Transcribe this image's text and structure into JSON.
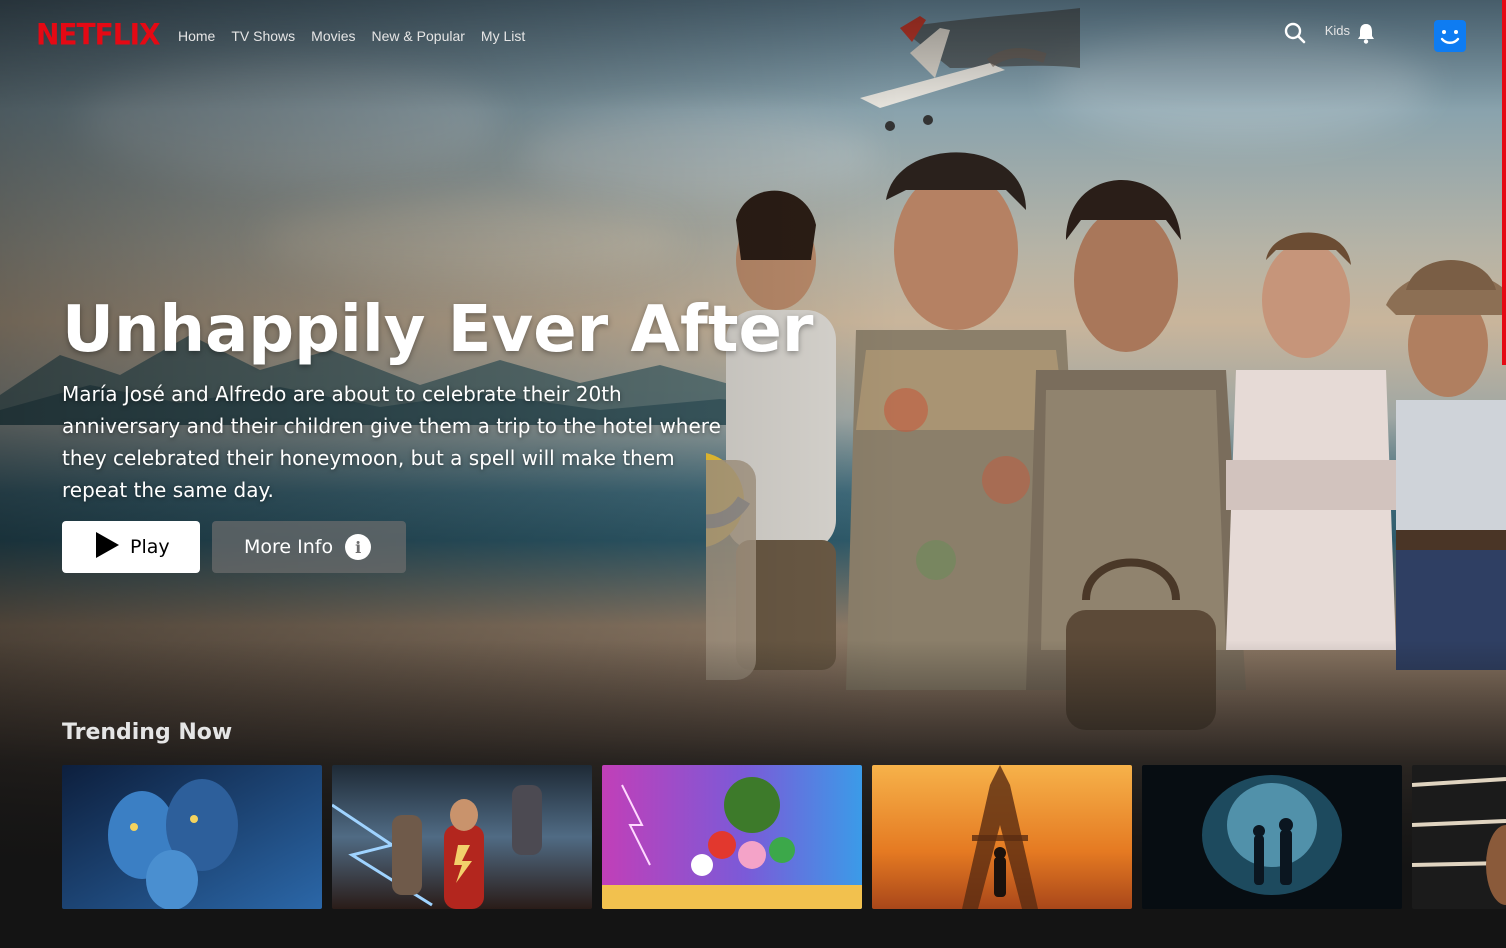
{
  "brand": {
    "logo_text": "NETFLIX",
    "color": "#e50914"
  },
  "nav": {
    "links": [
      "Home",
      "TV Shows",
      "Movies",
      "New & Popular",
      "My List"
    ],
    "kids_label": "Kids",
    "search_icon": "search-icon",
    "bell_icon": "bell-icon",
    "avatar_color": "#0e7cf2"
  },
  "hero": {
    "title": "Unhappily Ever After",
    "synopsis": "María José and Alfredo are about to celebrate their 20th anniversary and their children give them a trip to the hotel where they celebrated their honeymoon, but a spell will make them repeat the same day.",
    "play_label": "Play",
    "more_info_label": "More Info",
    "play_icon": "play-icon",
    "info_icon": "info-icon"
  },
  "rows": [
    {
      "title": "Trending Now",
      "items": [
        {
          "name": "avatar-poster",
          "palette": [
            "#1a3a6b",
            "#2b67a8",
            "#0d1f3d"
          ]
        },
        {
          "name": "shazam-poster",
          "palette": [
            "#34485c",
            "#b3261e",
            "#d9c27a"
          ]
        },
        {
          "name": "mario-poster",
          "palette": [
            "#c13fb8",
            "#3b9be8",
            "#f2c14e"
          ]
        },
        {
          "name": "john-wick-poster",
          "palette": [
            "#f0a23a",
            "#d9641c",
            "#3a1f10"
          ]
        },
        {
          "name": "dark-forest-poster",
          "palette": [
            "#0b1620",
            "#3f7a96",
            "#a8d6e6"
          ]
        },
        {
          "name": "partial-poster",
          "palette": [
            "#1b1b1b",
            "#5a4a3a",
            "#e0d4c0"
          ]
        }
      ]
    }
  ]
}
